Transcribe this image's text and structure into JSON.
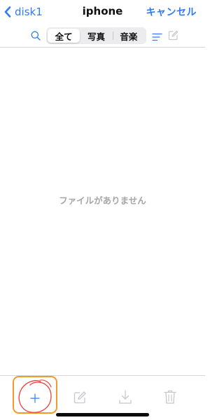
{
  "navbar": {
    "back_label": "disk1",
    "title": "iphone",
    "cancel_label": "キャンセル"
  },
  "filter": {
    "segments": [
      {
        "label": "全て",
        "selected": true
      },
      {
        "label": "写真",
        "selected": false
      },
      {
        "label": "音楽",
        "selected": false
      }
    ],
    "icons": [
      "search-icon",
      "sort-lines-icon",
      "edit-icon"
    ]
  },
  "main": {
    "empty_message": "ファイルがありません"
  },
  "toolbar": {
    "icons": [
      "plus-icon",
      "edit-icon",
      "download-icon",
      "trash-icon"
    ]
  },
  "colors": {
    "accent": "#2f7cf6",
    "text": "#111111",
    "muted_text": "#a6a6a6",
    "disabled_icon": "#c7c7cc",
    "highlight_box": "#f39a2c",
    "highlight_scribble": "#e8413a"
  }
}
